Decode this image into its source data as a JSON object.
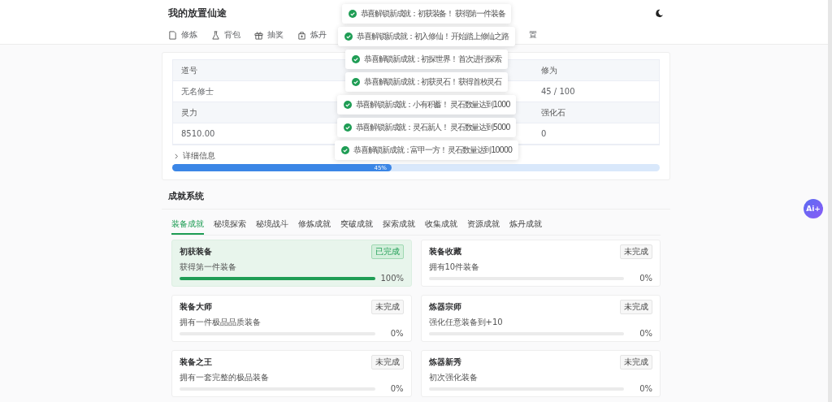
{
  "header": {
    "title": "我的放置仙途"
  },
  "nav": [
    {
      "label": "修炼"
    },
    {
      "label": "背包"
    },
    {
      "label": "抽奖"
    },
    {
      "label": "炼丹"
    },
    {
      "label": "置"
    }
  ],
  "stats": {
    "rows": [
      {
        "kind": "head",
        "cells": [
          "道号",
          "修为"
        ]
      },
      {
        "kind": "value",
        "cells": [
          "无名修士",
          "45 / 100"
        ]
      },
      {
        "kind": "head",
        "cells": [
          "灵力",
          "强化石"
        ]
      },
      {
        "kind": "value",
        "cells": [
          "8510.00",
          "0"
        ]
      }
    ],
    "details": {
      "label": "详细信息",
      "expanded": false
    },
    "progress": {
      "level": 0.45,
      "reading": "45%"
    }
  },
  "toasts": [
    {
      "text": "恭喜解锁新成就：初获装备！ 获得第一件装备"
    },
    {
      "text": "恭喜解锁新成就：初入修仙！ 开始踏上修仙之路"
    },
    {
      "text": "恭喜解锁新成就：初探世界！ 首次进行探索"
    },
    {
      "text": "恭喜解锁新成就：初获灵石！ 获得首枚灵石"
    },
    {
      "text": "恭喜解锁新成就：小有积蓄！ 灵石数量达到1000"
    },
    {
      "text": "恭喜解锁新成就：灵石新人！ 灵石数量达到5000"
    },
    {
      "text": "恭喜解锁新成就：富甲一方！ 灵石数量达到10000"
    }
  ],
  "achievements": {
    "title": "成就系统",
    "tabs": [
      {
        "label": "装备成就",
        "selected": true
      },
      {
        "label": "秘境探索",
        "selected": false
      },
      {
        "label": "秘境战斗",
        "selected": false
      },
      {
        "label": "修炼成就",
        "selected": false
      },
      {
        "label": "突破成就",
        "selected": false
      },
      {
        "label": "探索成就",
        "selected": false
      },
      {
        "label": "收集成就",
        "selected": false
      },
      {
        "label": "资源成就",
        "selected": false
      },
      {
        "label": "炼丹成就",
        "selected": false
      }
    ],
    "cards": [
      {
        "title": "初获装备",
        "status": "已完成",
        "completed": true,
        "description": "获得第一件装备",
        "level": 1,
        "reading": "100%"
      },
      {
        "title": "装备收藏",
        "status": "未完成",
        "completed": false,
        "description": "拥有10件装备",
        "level": 0,
        "reading": "0%"
      },
      {
        "title": "装备大师",
        "status": "未完成",
        "completed": false,
        "description": "拥有一件极品品质装备",
        "level": 0,
        "reading": "0%"
      },
      {
        "title": "炼器宗师",
        "status": "未完成",
        "completed": false,
        "description": "强化任意装备到+10",
        "level": 0,
        "reading": "0%"
      },
      {
        "title": "装备之王",
        "status": "未完成",
        "completed": false,
        "description": "拥有一套完整的极品装备",
        "level": 0,
        "reading": "0%"
      },
      {
        "title": "炼器新秀",
        "status": "未完成",
        "completed": false,
        "description": "初次强化装备",
        "level": 0,
        "reading": "0%"
      }
    ]
  },
  "assistant": {
    "label": "Ai+"
  }
}
